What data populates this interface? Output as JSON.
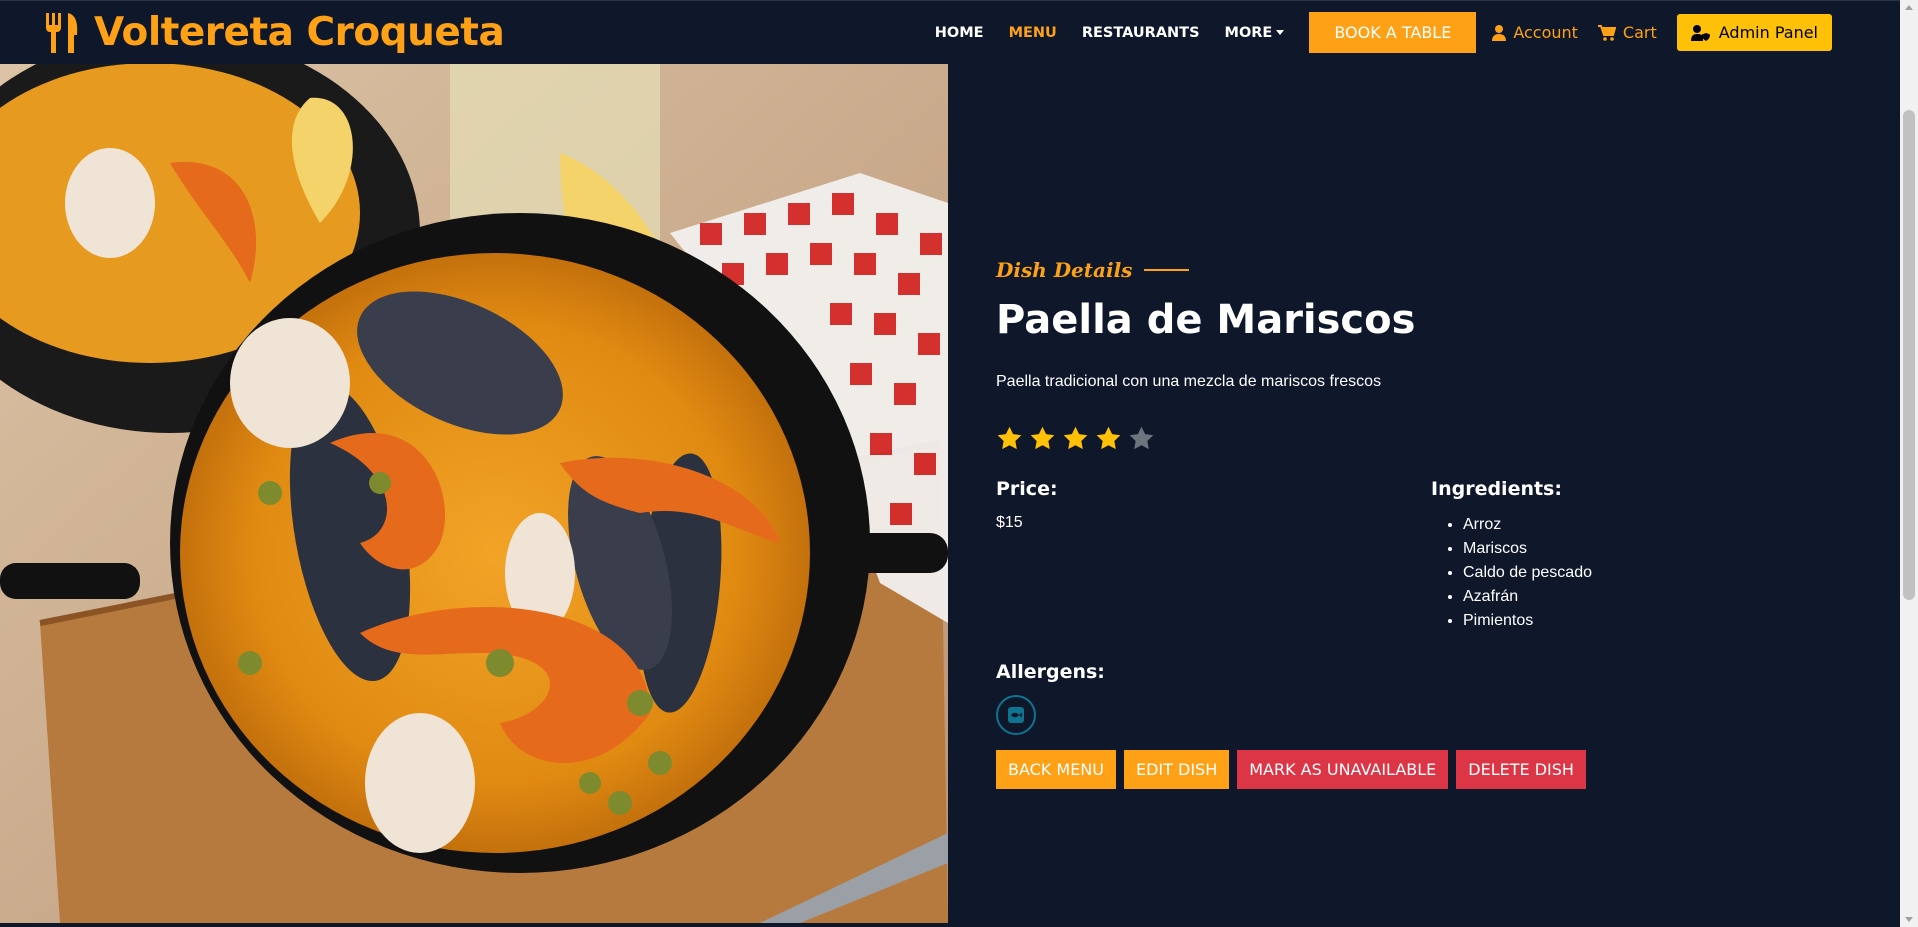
{
  "brand": {
    "name": "Voltereta Croqueta",
    "icon": "utensils-icon"
  },
  "nav": {
    "home": "HOME",
    "menu": "MENU",
    "restaurants": "RESTAURANTS",
    "more": "MORE",
    "book": "BOOK A TABLE",
    "account": "Account",
    "cart": "Cart",
    "admin": "Admin Panel"
  },
  "dish": {
    "eyebrow": "Dish Details",
    "name": "Paella de Mariscos",
    "description": "Paella tradicional con una mezcla de mariscos frescos",
    "rating": 4,
    "rating_max": 5,
    "price_label": "Price:",
    "price": "$15",
    "ingredients_label": "Ingredients:",
    "ingredients": [
      "Arroz",
      "Mariscos",
      "Caldo de pescado",
      "Azafrán",
      "Pimientos"
    ],
    "allergens_label": "Allergens:",
    "allergen_icons": [
      "fish-allergen-icon"
    ]
  },
  "actions": {
    "back": "BACK MENU",
    "edit": "EDIT DISH",
    "unavailable": "MARK AS UNAVAILABLE",
    "delete": "DELETE DISH"
  },
  "colors": {
    "background": "#0f172b",
    "accent": "#fea116",
    "admin": "#ffc107",
    "danger": "#dc3545"
  }
}
